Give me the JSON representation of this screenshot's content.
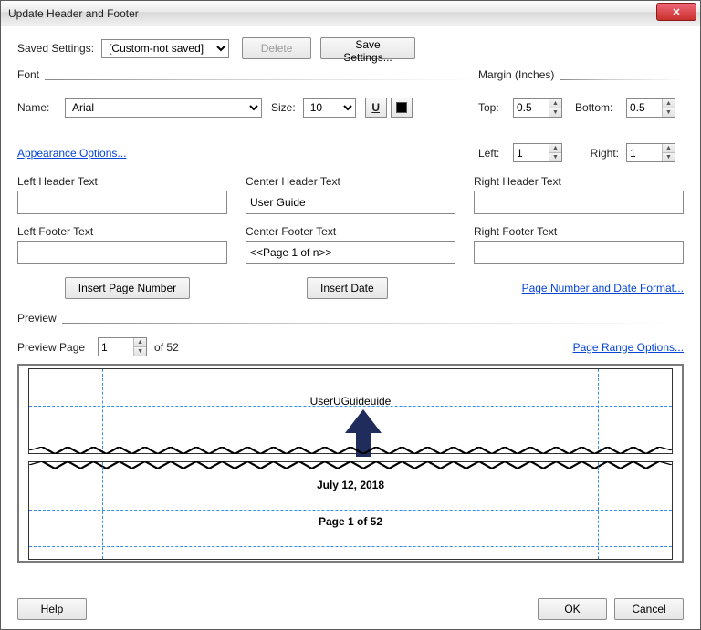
{
  "window": {
    "title": "Update Header and Footer"
  },
  "savedSettings": {
    "label": "Saved Settings:",
    "value": "[Custom-not saved]",
    "deleteLabel": "Delete",
    "saveLabel": "Save Settings..."
  },
  "font": {
    "sectionLabel": "Font",
    "nameLabel": "Name:",
    "nameValue": "Arial",
    "sizeLabel": "Size:",
    "sizeValue": "10",
    "underlineGlyph": "U",
    "colorHex": "#000000"
  },
  "margin": {
    "sectionLabel": "Margin (Inches)",
    "topLabel": "Top:",
    "topValue": "0.5",
    "bottomLabel": "Bottom:",
    "bottomValue": "0.5",
    "leftLabel": "Left:",
    "leftValue": "1",
    "rightLabel": "Right:",
    "rightValue": "1"
  },
  "links": {
    "appearance": "Appearance Options...",
    "pageDateFormat": "Page Number and Date Format...",
    "pageRange": "Page Range Options..."
  },
  "headers": {
    "leftLabel": "Left Header Text",
    "leftValue": "",
    "centerLabel": "Center Header Text",
    "centerValue": "User Guide",
    "rightLabel": "Right Header Text",
    "rightValue": ""
  },
  "footers": {
    "leftLabel": "Left Footer Text",
    "leftValue": "",
    "centerLabel": "Center Footer Text",
    "centerValue": "<<Page 1 of n>>",
    "rightLabel": "Right Footer Text",
    "rightValue": ""
  },
  "insert": {
    "pageNumber": "Insert Page Number",
    "date": "Insert Date"
  },
  "preview": {
    "sectionLabel": "Preview",
    "pageLabel": "Preview Page",
    "pageValue": "1",
    "ofLabel": "of 52",
    "headerLine": "UserUGuideuide",
    "dateLine": "July 12, 2018",
    "pageLine": "Page 1 of 52"
  },
  "buttons": {
    "help": "Help",
    "ok": "OK",
    "cancel": "Cancel"
  }
}
